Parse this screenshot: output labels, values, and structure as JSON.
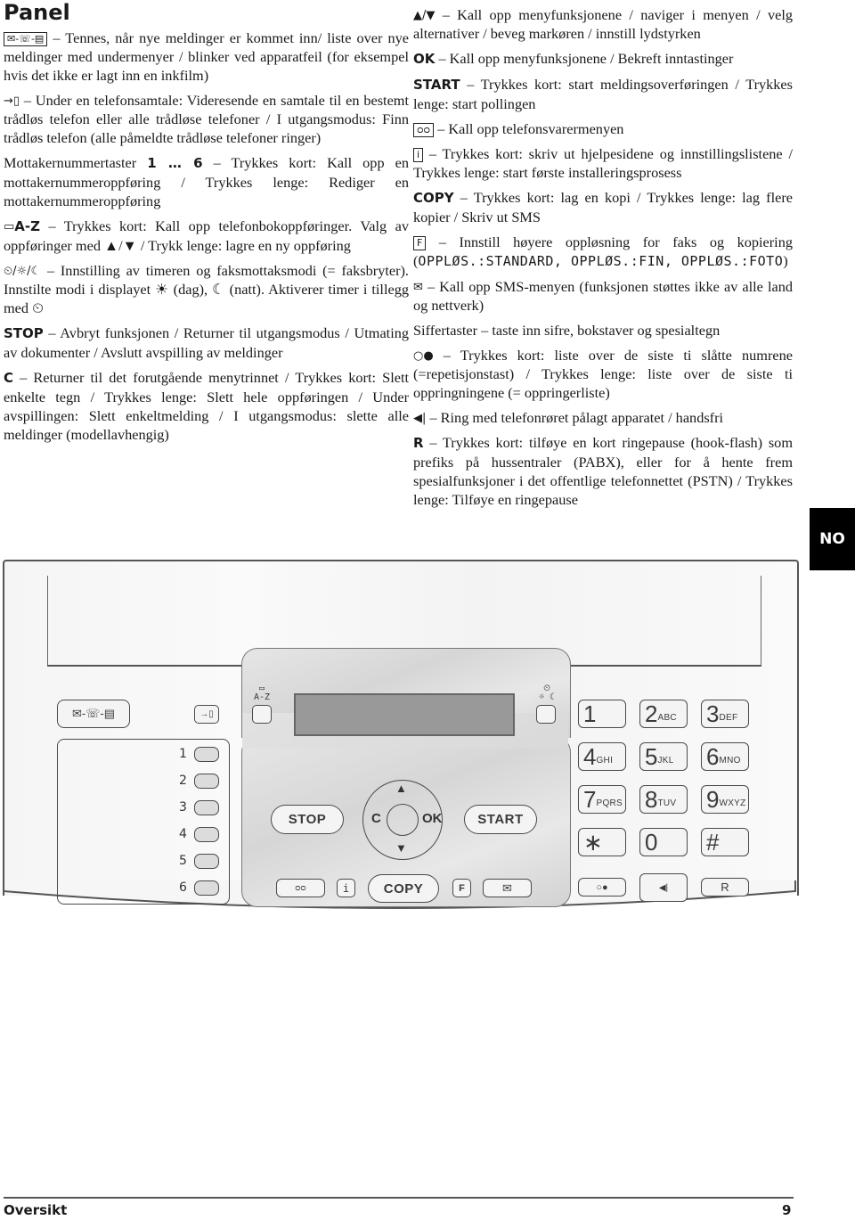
{
  "page_title": "Panel",
  "language_tab": "NO",
  "left_column": [
    {
      "icon": "message-line-fax-led-icon",
      "icon_text": "✉-☏-▤",
      "keyword": "",
      "text": " – Tennes, når nye meldinger er kommet inn/ liste over nye meldinger med undermenyer / blinker ved apparatfeil (for eksempel hvis det ikke er lagt inn en inkfilm)"
    },
    {
      "icon": "transfer-handset-icon",
      "icon_text": "→▯",
      "keyword": "",
      "text": " – Under en telefonsamtale: Videresende en samtale til en bestemt trådløs telefon eller alle trådløse telefoner / I utgangsmodus: Finn trådløs telefon (alle påmeldte trådløse telefoner ringer)"
    },
    {
      "prefix": "Mottakernummertaster ",
      "keyword": "1 … 6",
      "text": " – Trykkes kort: Kall opp en mottakernummeroppføring / Trykkes lenge: Rediger en mottakernummeroppføring"
    },
    {
      "icon": "phonebook-icon",
      "icon_text": "▭",
      "keyword": "A-Z",
      "text": " – Trykkes kort: Kall opp telefonbokoppføringer. Valg av oppføringer med ▲/▼ / Trykk lenge: lagre en ny oppføring"
    },
    {
      "icon": "timer-day-night-icon",
      "icon_text": "⏲/☼/☾",
      "keyword": "",
      "text": " – Innstilling av timeren og faksmottaksmodi (= faksbryter). Innstilte modi i displayet ☀ (dag), ☾ (natt). Aktiverer timer i tillegg med ⏲"
    },
    {
      "keyword": "STOP",
      "text": " – Avbryt funksjonen / Returner til utgangsmodus / Utmating av dokumenter / Avslutt avspilling av meldinger"
    },
    {
      "keyword": "C",
      "text": " – Returner til det forutgående menytrinnet / Trykkes kort: Slett enkelte tegn / Trykkes lenge: Slett hele oppføringen / Under avspillingen: Slett enkeltmelding / I utgangsmodus: slette alle meldinger (modellavhengig)"
    }
  ],
  "right_column": [
    {
      "icon": "up-down-arrows-icon",
      "icon_text": "▲/▼",
      "keyword": "",
      "text": " – Kall opp menyfunksjonene / naviger i menyen / velg alternativer / beveg markøren / innstill lydstyrken"
    },
    {
      "keyword": "OK",
      "text": " – Kall opp menyfunksjonene / Bekreft inntastinger"
    },
    {
      "keyword": "START",
      "text": " – Trykkes kort: start meldingsoverføringen / Trykkes lenge: start pollingen"
    },
    {
      "icon": "answering-machine-icon",
      "icon_text": "ᴑᴑ",
      "keyword": "",
      "text": " – Kall opp telefonsvarermenyen"
    },
    {
      "icon": "info-icon",
      "icon_text": "i",
      "keyword": "",
      "text": " – Trykkes kort: skriv ut hjelpesidene og innstillingslistene / Trykkes lenge: start første installeringsprosess"
    },
    {
      "keyword": "COPY",
      "text": " – Trykkes kort: lag en kopi / Trykkes lenge: lag flere kopier / Skriv ut SMS"
    },
    {
      "icon": "resolution-icon",
      "icon_text": "F",
      "keyword": "",
      "text": " – Innstill høyere oppløsning for faks og kopiering (",
      "mono": "OPPLØS.:STANDARD, OPPLØS.:FIN, OPPLØS.:FOTO",
      "suffix": ")"
    },
    {
      "icon": "sms-envelope-icon",
      "icon_text": "✉",
      "keyword": "",
      "text": " – Kall opp SMS-menyen (funksjonen støttes ikke av alle land og nettverk)"
    },
    {
      "prefix": "Siffertaster",
      "keyword": "",
      "text": " – taste inn sifre, bokstaver og spesialtegn"
    },
    {
      "icon": "redial-icon",
      "icon_text": "○●",
      "keyword": "",
      "text": " – Trykkes kort: liste over de siste ti slåtte numrene (=repetisjonstast) / Trykkes lenge: liste over de siste ti oppringningene (= oppringerliste)"
    },
    {
      "icon": "speaker-icon",
      "icon_text": "◀|",
      "keyword": "",
      "text": " – Ring med telefonrøret pålagt apparatet / handsfri"
    },
    {
      "keyword": "R",
      "text": " – Trykkes kort: tilføye en kort ringepause (hook-flash) som prefiks på hussentraler (PABX), eller for å hente frem spesialfunksjoner i det offentlige telefonnettet (PSTN) / Trykkes lenge: Tilføye en ringepause"
    }
  ],
  "device": {
    "led_label": "✉-☏-▤",
    "transfer_label": "→▯",
    "phonebook_label": "A-Z",
    "timer_label": "☼ ☾",
    "destination_keys": [
      "1",
      "2",
      "3",
      "4",
      "5",
      "6"
    ],
    "stop_label": "STOP",
    "c_label": "C",
    "ok_label": "OK",
    "up_label": "▲",
    "down_label": "▼",
    "start_label": "START",
    "copy_label": "COPY",
    "tam_label": "ᴑᴑ",
    "info_label": "i",
    "resolution_label": "F",
    "sms_label": "✉",
    "keypad": [
      {
        "digit": "1",
        "letters": ""
      },
      {
        "digit": "2",
        "letters": "ABC"
      },
      {
        "digit": "3",
        "letters": "DEF"
      },
      {
        "digit": "4",
        "letters": "GHI"
      },
      {
        "digit": "5",
        "letters": "JKL"
      },
      {
        "digit": "6",
        "letters": "MNO"
      },
      {
        "digit": "7",
        "letters": "PQRS"
      },
      {
        "digit": "8",
        "letters": "TUV"
      },
      {
        "digit": "9",
        "letters": "WXYZ"
      },
      {
        "digit": "∗",
        "letters": ""
      },
      {
        "digit": "0",
        "letters": ""
      },
      {
        "digit": "#",
        "letters": ""
      }
    ],
    "redial_label": "○●",
    "speaker_label": "◀|",
    "r_label": "R"
  },
  "footer": {
    "section": "Oversikt",
    "page_number": "9"
  }
}
